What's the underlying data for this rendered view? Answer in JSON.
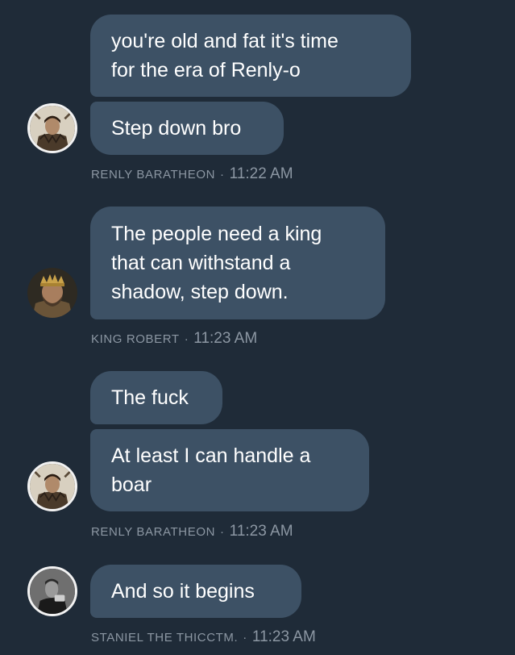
{
  "messages": [
    {
      "lines": [
        "you're old and fat it's time",
        "for the era of Renly-o"
      ]
    },
    {
      "lines": [
        "Step down bro"
      ]
    },
    {
      "lines": [
        "The people need a king",
        "that can withstand a",
        "shadow, step down."
      ]
    },
    {
      "lines": [
        "The fuck"
      ]
    },
    {
      "lines": [
        "At least I can handle a",
        "boar"
      ]
    },
    {
      "lines": [
        "And so it begins"
      ]
    }
  ],
  "meta": [
    {
      "sender": "RENLY BARATHEON",
      "time": "11:22 AM"
    },
    {
      "sender": "KING ROBERT",
      "time": "11:23 AM"
    },
    {
      "sender": "RENLY BARATHEON",
      "time": "11:23 AM"
    },
    {
      "sender": "STANIEL THE THICCTM.",
      "time": "11:23 AM"
    }
  ],
  "separator": "·",
  "avatars": [
    "renly-avatar",
    "robert-avatar",
    "renly-avatar",
    "stannis-avatar"
  ]
}
